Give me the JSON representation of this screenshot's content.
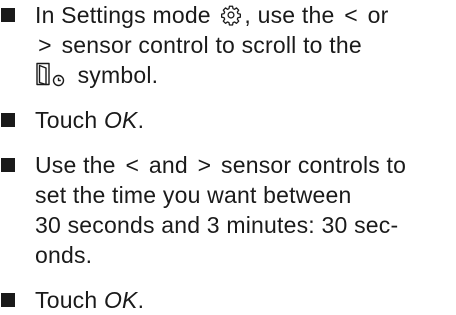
{
  "steps": [
    {
      "lines": [
        {
          "a": "In Settings mode ",
          "b": ", use the ",
          "c": " or"
        },
        {
          "b": " sensor control to scroll to the"
        },
        {
          "b": " symbol."
        }
      ],
      "less": "<",
      "greater": ">"
    },
    {
      "before": "Touch ",
      "em": "OK",
      "after": "."
    },
    {
      "line1a": "Use the ",
      "line1b": " and ",
      "line1c": " sensor controls to",
      "line2": "set the time you want between",
      "line3": "30 seconds and 3 minutes: 30 sec-",
      "line4": "onds.",
      "less": "<",
      "greater": ">"
    },
    {
      "before": "Touch ",
      "em": "OK",
      "after": "."
    }
  ],
  "icons": {
    "settings": "gear-icon",
    "door_timer": "door-timer-icon"
  }
}
